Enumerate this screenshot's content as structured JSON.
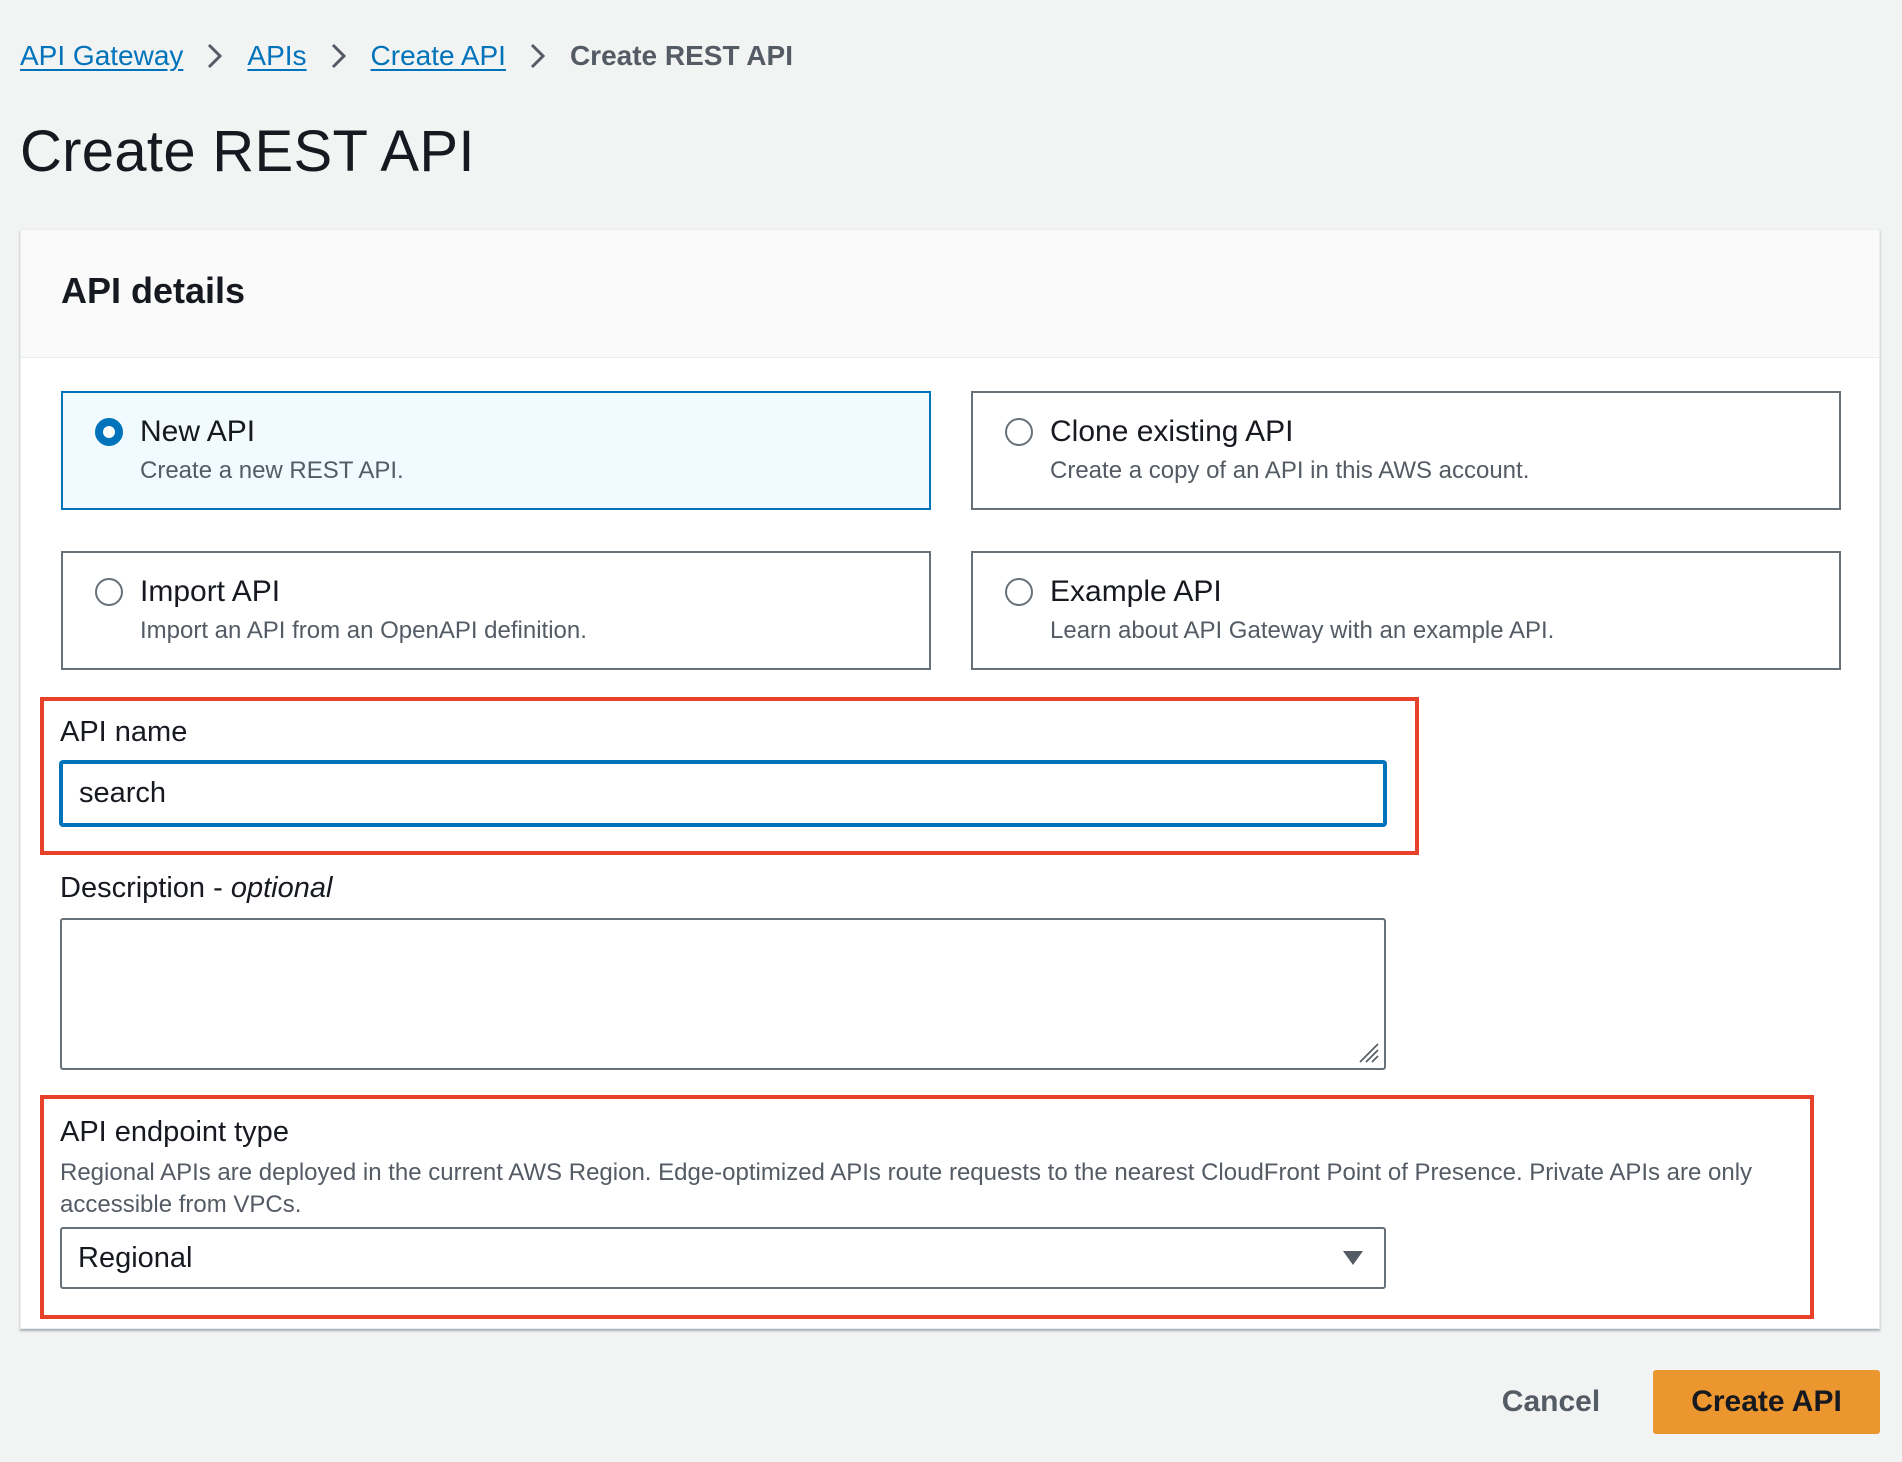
{
  "breadcrumb": {
    "items": [
      "API Gateway",
      "APIs",
      "Create API"
    ],
    "current": "Create REST API"
  },
  "page_title": "Create REST API",
  "panel": {
    "title": "API details",
    "options": [
      {
        "label": "New API",
        "description": "Create a new REST API.",
        "selected": true
      },
      {
        "label": "Clone existing API",
        "description": "Create a copy of an API in this AWS account.",
        "selected": false
      },
      {
        "label": "Import API",
        "description": "Import an API from an OpenAPI definition.",
        "selected": false
      },
      {
        "label": "Example API",
        "description": "Learn about API Gateway with an example API.",
        "selected": false
      }
    ]
  },
  "api_name": {
    "label": "API name",
    "value": "search"
  },
  "description": {
    "label": "Description - ",
    "label_optional": "optional",
    "value": ""
  },
  "endpoint_type": {
    "label": "API endpoint type",
    "hint": "Regional APIs are deployed in the current AWS Region. Edge-optimized APIs route requests to the nearest CloudFront Point of Presence. Private APIs are only accessible from VPCs.",
    "selected": "Regional"
  },
  "actions": {
    "cancel_label": "Cancel",
    "create_label": "Create API"
  },
  "colors": {
    "link": "#0073bb",
    "primary_button": "#ec9630",
    "highlight": "#e8402a",
    "selected_tile_bg": "#f1faff"
  }
}
